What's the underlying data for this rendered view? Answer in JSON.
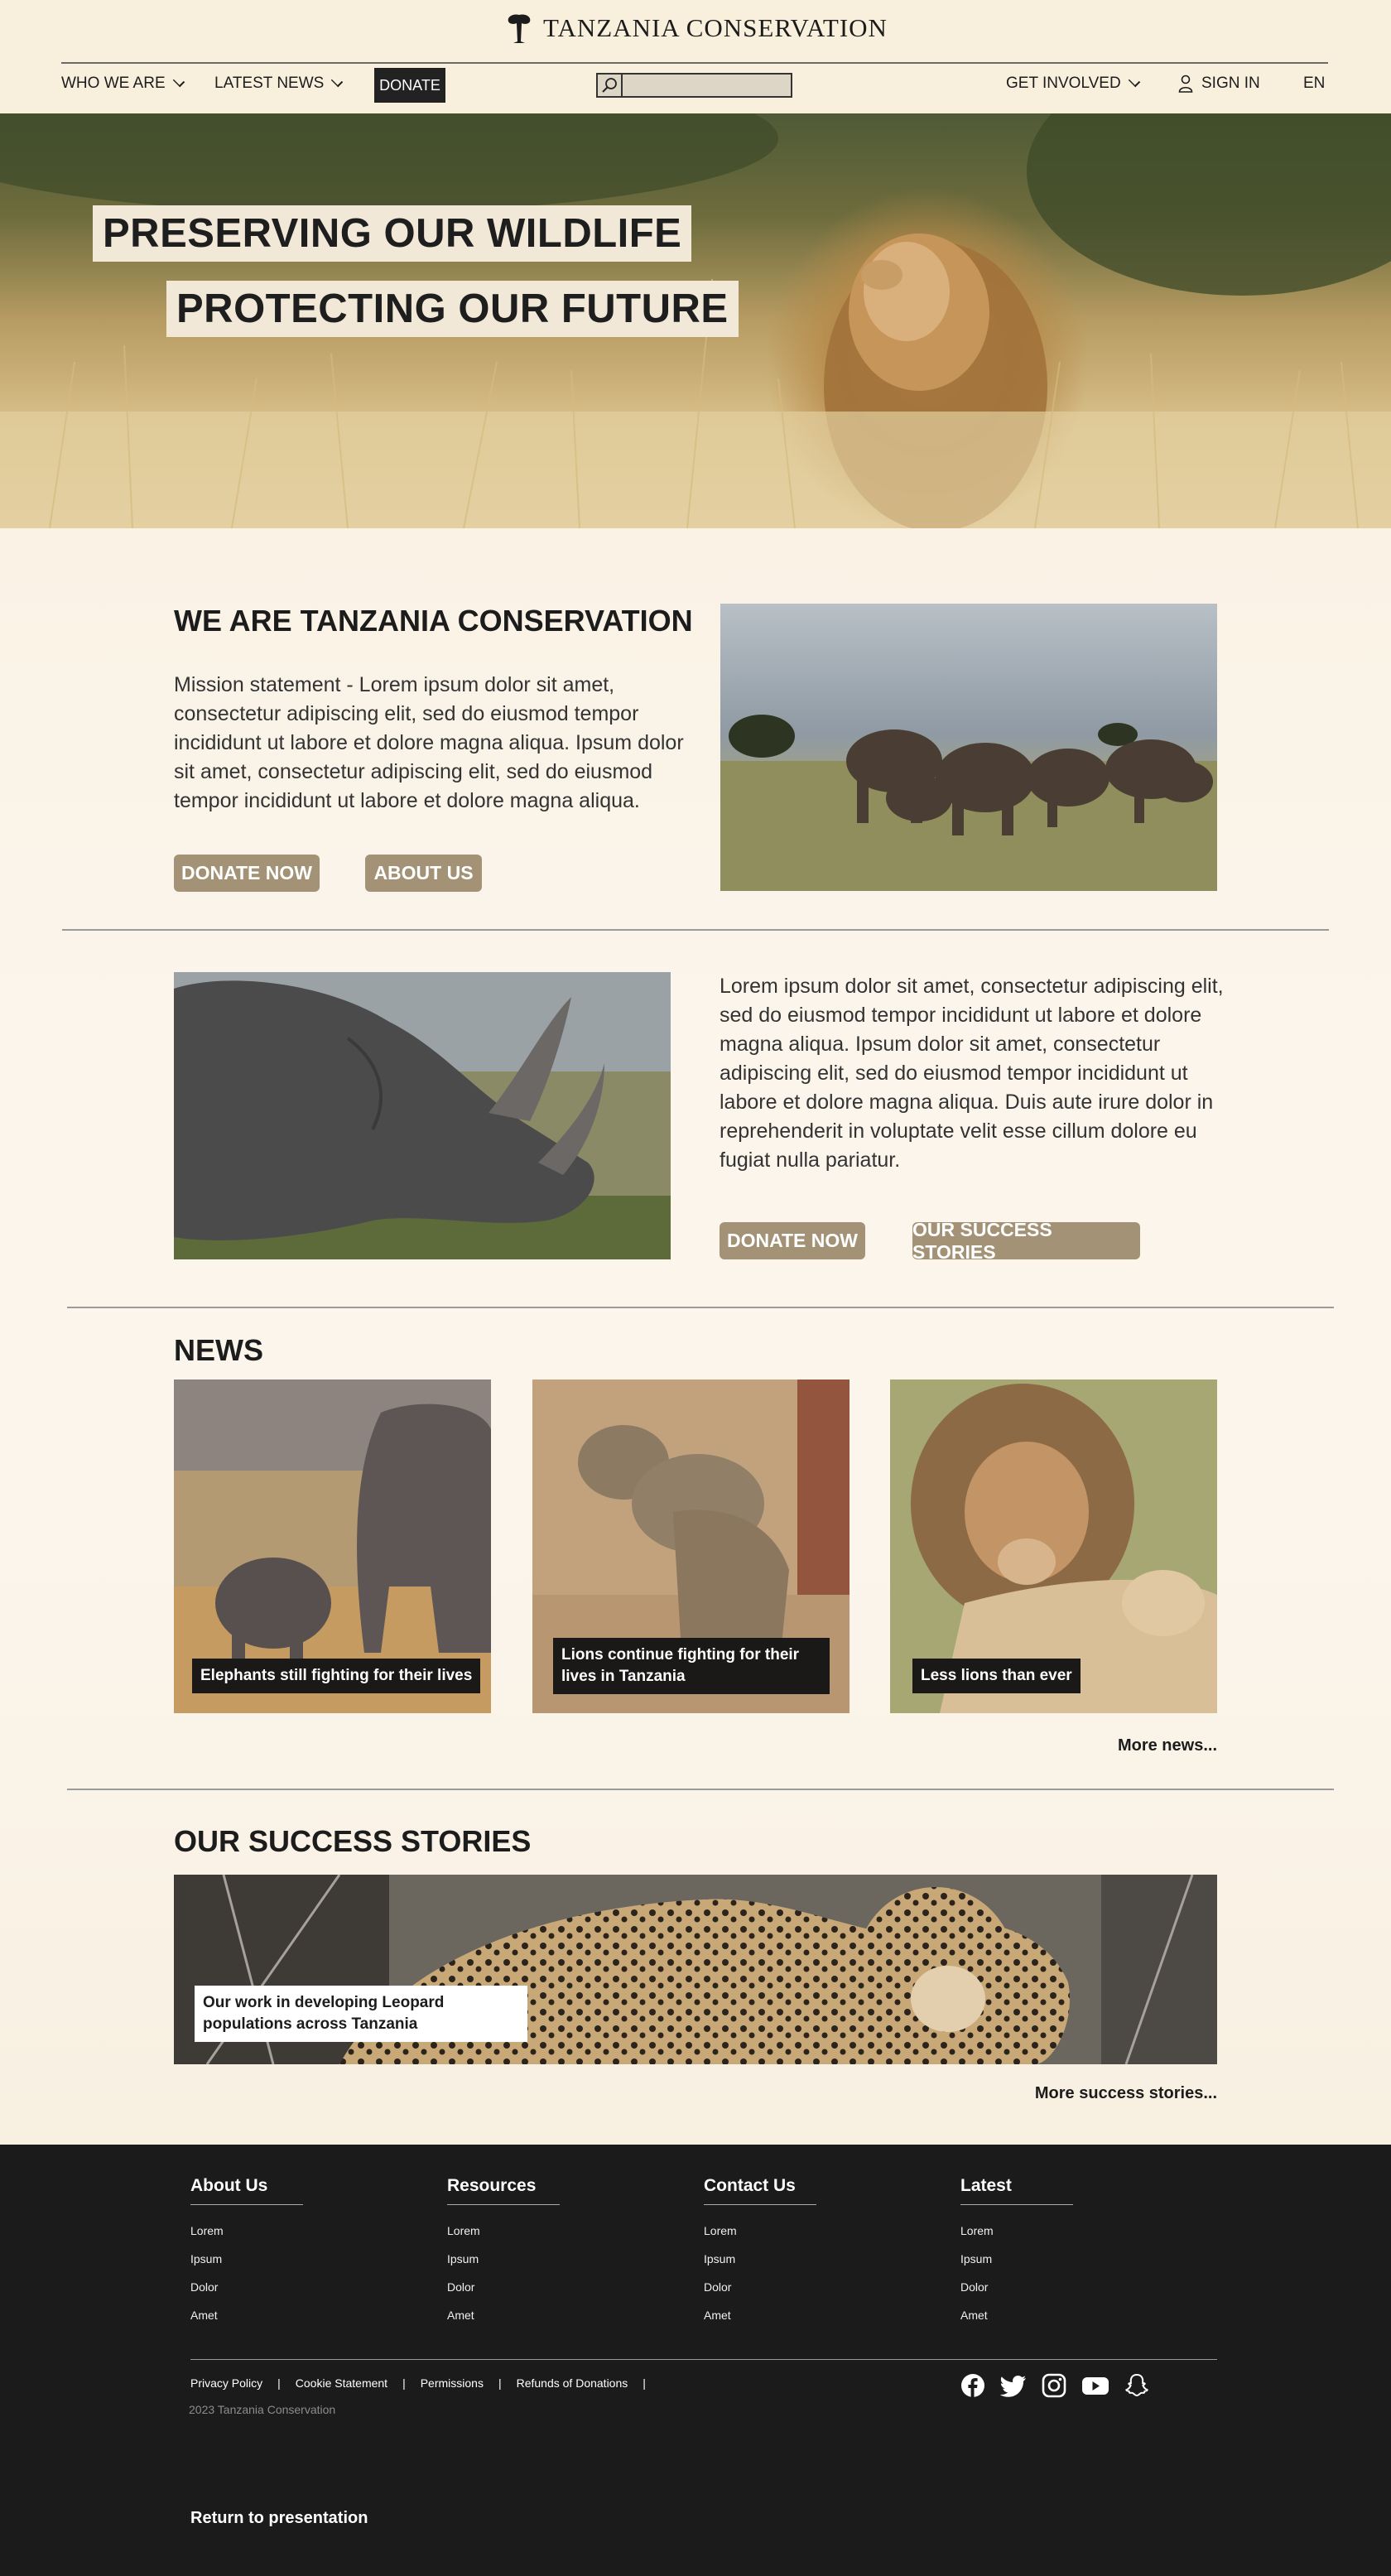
{
  "header": {
    "brand": "TANZANIA CONSERVATION",
    "nav": {
      "who_we_are": "WHO WE ARE",
      "latest_news": "LATEST NEWS",
      "donate": "DONATE",
      "search_placeholder": "",
      "get_involved": "GET INVOLVED",
      "sign_in": "SIGN IN",
      "language": "EN"
    }
  },
  "hero": {
    "line1": "PRESERVING OUR WILDLIFE",
    "line2": "PROTECTING OUR FUTURE"
  },
  "about": {
    "heading": "WE ARE TANZANIA CONSERVATION",
    "text": "Mission statement - Lorem ipsum dolor sit amet, consectetur adipiscing elit, sed do eiusmod tempor incididunt ut labore et dolore magna aliqua. Ipsum dolor sit amet, consectetur adipiscing elit, sed do eiusmod tempor incididunt ut labore et dolore magna aliqua.",
    "donate_btn": "DONATE NOW",
    "about_btn": "ABOUT US"
  },
  "rhino": {
    "text": "Lorem ipsum dolor sit amet, consectetur adipiscing elit, sed do eiusmod tempor incididunt ut labore et dolore magna aliqua. Ipsum dolor sit amet, consectetur adipiscing elit, sed do eiusmod tempor incididunt ut labore et dolore magna aliqua. Duis aute irure dolor in reprehenderit in voluptate velit esse cillum dolore eu fugiat nulla pariatur.",
    "donate_btn": "DONATE NOW",
    "stories_btn": "OUR SUCCESS STORIES"
  },
  "news": {
    "heading": "NEWS",
    "items": [
      {
        "caption": "Elephants still fighting for their lives"
      },
      {
        "caption": "Lions continue fighting for their lives in Tanzania"
      },
      {
        "caption": "Less lions than ever"
      }
    ],
    "more": "More news..."
  },
  "success": {
    "heading": "OUR SUCCESS STORIES",
    "caption": "Our work in developing Leopard populations across Tanzania",
    "more": "More success stories..."
  },
  "footer": {
    "columns": [
      {
        "title": "About Us",
        "items": [
          "Lorem",
          "Ipsum",
          "Dolor",
          "Amet"
        ]
      },
      {
        "title": "Resources",
        "items": [
          "Lorem",
          "Ipsum",
          "Dolor",
          "Amet"
        ]
      },
      {
        "title": "Contact Us",
        "items": [
          "Lorem",
          "Ipsum",
          "Dolor",
          "Amet"
        ]
      },
      {
        "title": "Latest",
        "items": [
          "Lorem",
          "Ipsum",
          "Dolor",
          "Amet"
        ]
      }
    ],
    "links": [
      "Privacy Policy",
      "Cookie Statement",
      "Permissions",
      "Refunds of Donations"
    ],
    "copyright": "2023 Tanzania Conservation",
    "social": [
      "facebook-icon",
      "twitter-icon",
      "instagram-icon",
      "youtube-icon",
      "snapchat-icon"
    ],
    "return": "Return to presentation"
  }
}
